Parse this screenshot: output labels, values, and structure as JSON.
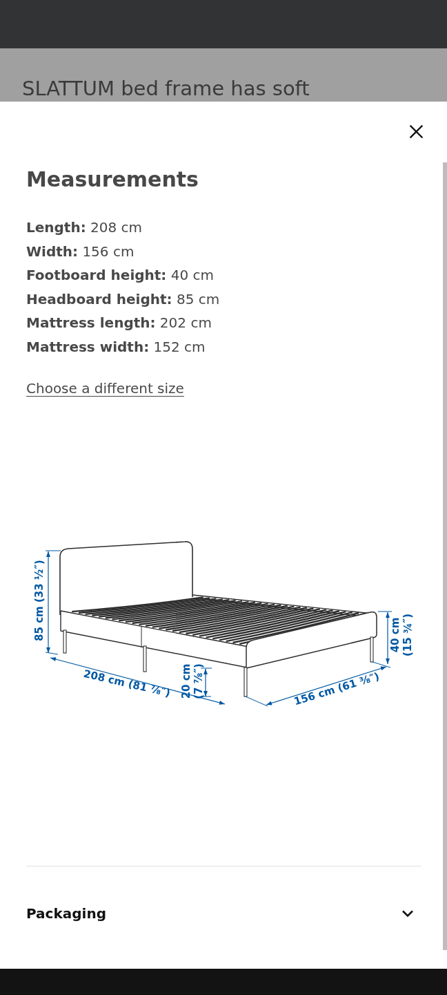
{
  "background_page": {
    "text": "SLATTUM bed frame has soft"
  },
  "dialog": {
    "title": "Measurements",
    "measurements": [
      "**Length:** 208 cm",
      "**Width:** 156 cm",
      "**Footboard height:** 40 cm",
      "**Headboard height:** 85 cm",
      "**Mattress length:** 202 cm",
      "**Mattress width:** 152 cm"
    ],
    "link": "Choose a different size",
    "drawing": {
      "dimension_labels": [
        {
          "lines": [
            "85 cm (33 ½″)"
          ]
        },
        {
          "lines": [
            "208 cm (81 ⅞″)"
          ]
        },
        {
          "lines": [
            "20 cm",
            "(7 ⅞″)"
          ]
        },
        {
          "lines": [
            "156 cm (61 ⅜″)"
          ]
        },
        {
          "lines": [
            "40 cm",
            "(15 ¾″)"
          ]
        }
      ]
    },
    "sections": [
      {
        "title": "Packaging",
        "expanded": false
      }
    ]
  }
}
